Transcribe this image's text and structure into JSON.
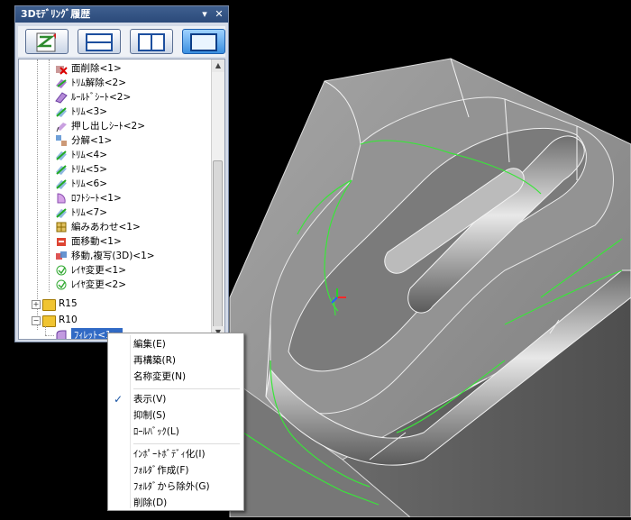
{
  "panel": {
    "title": "3Dﾓﾃﾞﾘﾝｸﾞ履歴",
    "pin_glyph": "▾",
    "close_glyph": "✕",
    "toolbar": [
      {
        "name": "toolbar-history-button",
        "icon": "history-zigzag-icon",
        "active": false
      },
      {
        "name": "toolbar-split-horizontal-button",
        "icon": "split-horizontal-icon",
        "active": false
      },
      {
        "name": "toolbar-split-vertical-button",
        "icon": "split-vertical-icon",
        "active": false
      },
      {
        "name": "toolbar-single-view-button",
        "icon": "single-view-icon",
        "active": true
      }
    ],
    "tree": {
      "items": [
        {
          "label": "面削除<1>",
          "icon": "face-delete-icon"
        },
        {
          "label": "ﾄﾘﾑ解除<2>",
          "icon": "untrim-icon"
        },
        {
          "label": "ﾙｰﾙﾄﾞｼｰﾄ<2>",
          "icon": "ruled-sheet-icon"
        },
        {
          "label": "ﾄﾘﾑ<3>",
          "icon": "trim-icon"
        },
        {
          "label": "押し出しｼｰﾄ<2>",
          "icon": "extrude-sheet-icon"
        },
        {
          "label": "分解<1>",
          "icon": "explode-icon"
        },
        {
          "label": "ﾄﾘﾑ<4>",
          "icon": "trim-icon"
        },
        {
          "label": "ﾄﾘﾑ<5>",
          "icon": "trim-icon"
        },
        {
          "label": "ﾄﾘﾑ<6>",
          "icon": "trim-icon"
        },
        {
          "label": "ﾛﾌﾄｼｰﾄ<1>",
          "icon": "loft-sheet-icon"
        },
        {
          "label": "ﾄﾘﾑ<7>",
          "icon": "trim-icon"
        },
        {
          "label": "編みあわせ<1>",
          "icon": "knit-icon"
        },
        {
          "label": "面移動<1>",
          "icon": "face-move-icon"
        },
        {
          "label": "移動,複写(3D)<1>",
          "icon": "move-copy-icon"
        },
        {
          "label": "ﾚｲﾔ変更<1>",
          "icon": "layer-change-icon"
        },
        {
          "label": "ﾚｲﾔ変更<2>",
          "icon": "layer-change-icon"
        }
      ],
      "folders": [
        {
          "label": "R15",
          "expander": "+"
        },
        {
          "label": "R10",
          "expander": "−"
        }
      ],
      "selected_child": {
        "label": "ﾌｨﾚｯﾄ<1>",
        "icon": "fillet-icon"
      },
      "scroll_up": "▲",
      "scroll_down": "▼"
    }
  },
  "context_menu": {
    "items": [
      {
        "label": "編集(E)",
        "checked": false
      },
      {
        "label": "再構築(R)",
        "checked": false
      },
      {
        "label": "名称変更(N)",
        "checked": false
      },
      {
        "separator": true
      },
      {
        "label": "表示(V)",
        "checked": true
      },
      {
        "label": "抑制(S)",
        "checked": false
      },
      {
        "label": "ﾛｰﾙﾊﾞｯｸ(L)",
        "checked": false
      },
      {
        "separator": true
      },
      {
        "label": "ｲﾝﾎﾟｰﾄﾎﾞﾃﾞｨ化(I)",
        "checked": false
      },
      {
        "label": "ﾌｫﾙﾀﾞ作成(F)",
        "checked": false
      },
      {
        "label": "ﾌｫﾙﾀﾞから除外(G)",
        "checked": false
      },
      {
        "label": "削除(D)",
        "checked": false
      }
    ],
    "check_glyph": "✓"
  },
  "viewport": {
    "background": "#000000",
    "model_color": "#8a8a8a",
    "edge_color": "#f2f2f2",
    "highlight_color": "#39e639"
  }
}
